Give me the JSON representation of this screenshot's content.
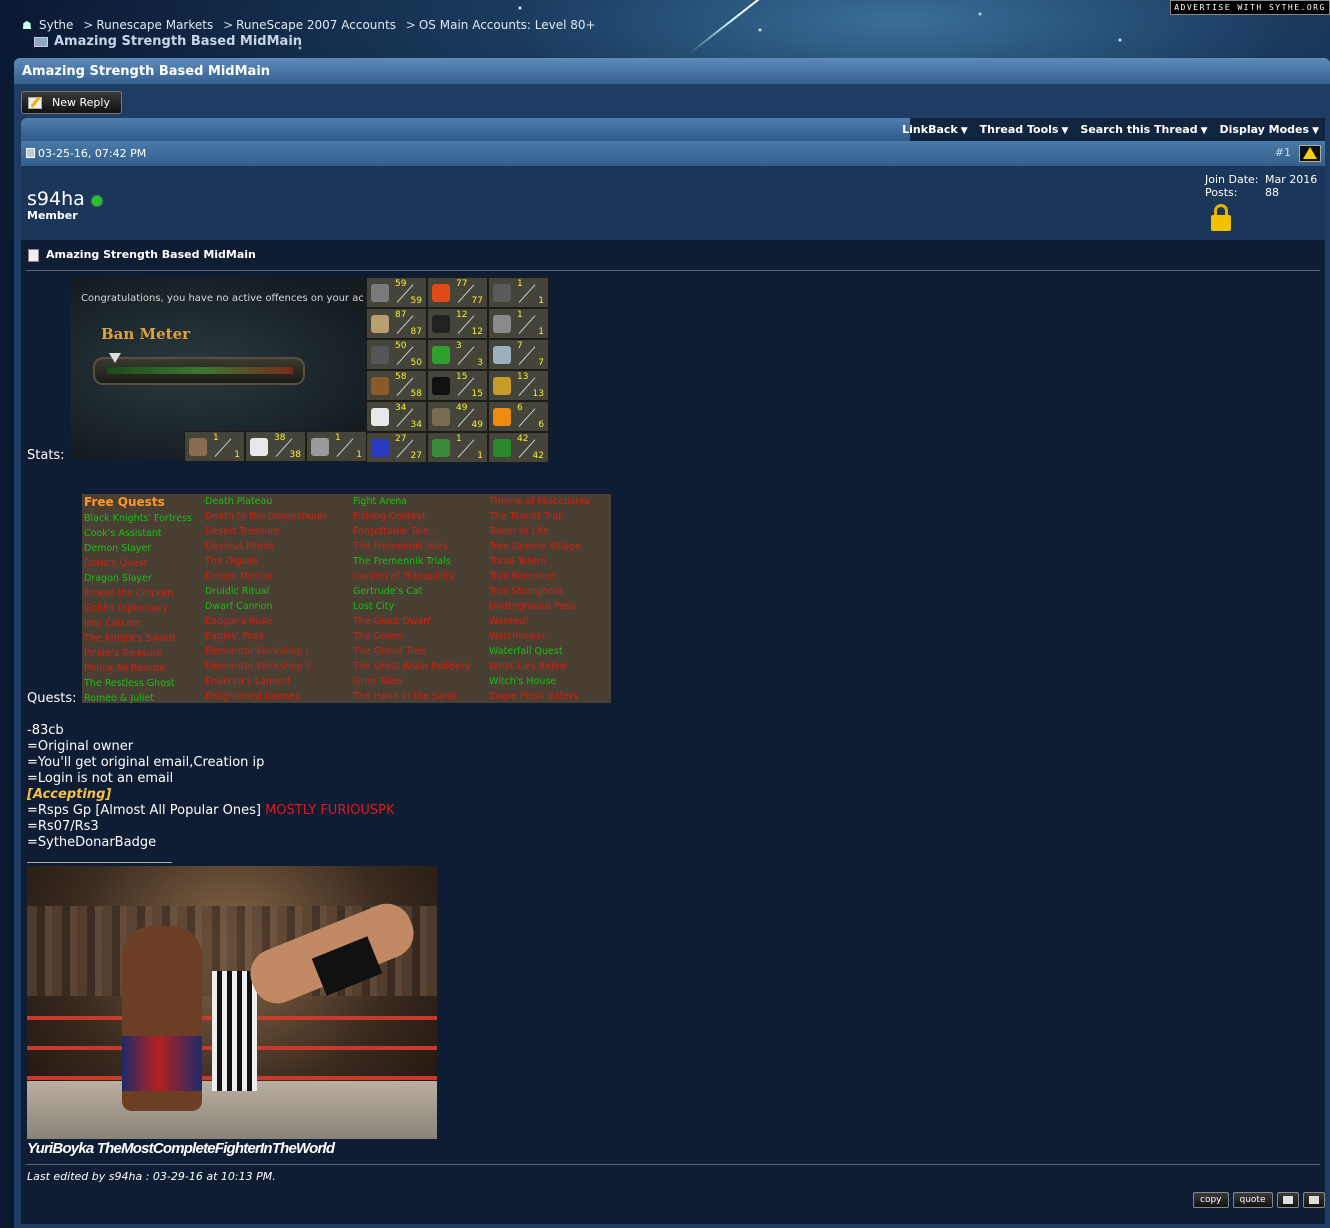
{
  "header": {
    "advertise": "ADVERTISE WITH SYTHE.ORG",
    "breadcrumb": [
      "Sythe",
      "Runescape Markets",
      "RuneScape 2007 Accounts",
      "OS Main Accounts: Level 80+"
    ],
    "breadcrumb_sep": ">",
    "current_thread": "Amazing Strength Based MidMain"
  },
  "thread": {
    "title": "Amazing Strength Based MidMain",
    "new_reply_label": "New Reply",
    "tools": [
      "LinkBack",
      "Thread Tools",
      "Search this Thread",
      "Display Modes"
    ]
  },
  "post": {
    "date": "03-25-16, 07:42 PM",
    "number": "#1",
    "username": "s94ha",
    "user_title": "Member",
    "join_date_label": "Join Date:",
    "join_date": "Mar 2016",
    "posts_label": "Posts:",
    "posts": "88",
    "title": "Amazing Strength Based MidMain",
    "stats_label": "Stats:",
    "quests_label": "Quests:",
    "lines": [
      "-83cb",
      "=Original owner",
      "=You'll get original email,Creation ip",
      "=Login is not an email"
    ],
    "accepting": "[Accepting]",
    "accept_line_prefix": "=Rsps Gp [Almost All Popular Ones]",
    "accept_line_highlight": "MOSTLY FURIOUSPK",
    "lines2": [
      "=Rs07/Rs3",
      "=SytheDonarBadge"
    ],
    "signature_caption": "YuriBoyka TheMostCompleteFighterInTheWorld",
    "edited": "Last edited by s94ha : 03-29-16 at 10:13 PM.",
    "buttons": {
      "copy": "copy",
      "quote": "quote"
    }
  },
  "ban_meter": {
    "congrats": "Congratulations, you have no active offences on your ac",
    "title": "Ban Meter"
  },
  "skills": [
    {
      "name": "attack-icon",
      "color": "#7a7a7a",
      "level": "59",
      "base": "59"
    },
    {
      "name": "hitpoints-icon",
      "color": "#e04a18",
      "level": "77",
      "base": "77"
    },
    {
      "name": "mining-icon",
      "color": "#5a5a5a",
      "level": "1",
      "base": "1"
    },
    {
      "name": "strength-icon",
      "color": "#b8a070",
      "level": "87",
      "base": "87"
    },
    {
      "name": "agility-icon",
      "color": "#222222",
      "level": "12",
      "base": "12"
    },
    {
      "name": "smithing-icon",
      "color": "#8a8a8a",
      "level": "1",
      "base": "1"
    },
    {
      "name": "defence-icon",
      "color": "#555555",
      "level": "50",
      "base": "50"
    },
    {
      "name": "herblore-icon",
      "color": "#2ea02e",
      "level": "3",
      "base": "3"
    },
    {
      "name": "fishing-icon",
      "color": "#9ab0c0",
      "level": "7",
      "base": "7"
    },
    {
      "name": "ranged-icon",
      "color": "#8a5a2a",
      "level": "58",
      "base": "58"
    },
    {
      "name": "thieving-icon",
      "color": "#111111",
      "level": "15",
      "base": "15"
    },
    {
      "name": "cooking-icon",
      "color": "#c89a2a",
      "level": "13",
      "base": "13"
    },
    {
      "name": "prayer-icon",
      "color": "#e8e8e8",
      "level": "34",
      "base": "34"
    },
    {
      "name": "crafting-icon",
      "color": "#7a6a50",
      "level": "49",
      "base": "49"
    },
    {
      "name": "firemaking-icon",
      "color": "#f08a10",
      "level": "6",
      "base": "6"
    },
    {
      "name": "magic-icon",
      "color": "#2a3ac0",
      "level": "27",
      "base": "27"
    },
    {
      "name": "fletching-icon",
      "color": "#3a8a3a",
      "level": "1",
      "base": "1"
    },
    {
      "name": "woodcutting-icon",
      "color": "#2a8a2a",
      "level": "42",
      "base": "42"
    }
  ],
  "skills_bottom": [
    {
      "name": "runecraft-icon",
      "color": "#8a6a50",
      "level": "1",
      "base": "1"
    },
    {
      "name": "slayer-icon",
      "color": "#e8e8e8",
      "level": "38",
      "base": "38"
    },
    {
      "name": "farming-icon",
      "color": "#9a9a9a",
      "level": "1",
      "base": "1"
    }
  ],
  "quests": {
    "header": "Free Quests",
    "columns": [
      [
        {
          "t": "Black Knights' Fortress",
          "c": "green"
        },
        {
          "t": "Cook's Assistant",
          "c": "green"
        },
        {
          "t": "Demon Slayer",
          "c": "green"
        },
        {
          "t": "Doric's Quest",
          "c": "red"
        },
        {
          "t": "Dragon Slayer",
          "c": "green"
        },
        {
          "t": "Ernest the Chicken",
          "c": "red"
        },
        {
          "t": "Goblin Diplomacy",
          "c": "red"
        },
        {
          "t": "Imp Catcher",
          "c": "red"
        },
        {
          "t": "The Knight's Sword",
          "c": "red"
        },
        {
          "t": "Pirate's Treasure",
          "c": "red"
        },
        {
          "t": "Prince Ali Rescue",
          "c": "red"
        },
        {
          "t": "The Restless Ghost",
          "c": "green"
        },
        {
          "t": "Romeo & Juliet",
          "c": "green"
        }
      ],
      [
        {
          "t": "Death Plateau",
          "c": "green"
        },
        {
          "t": "Death to the Dorgeshuun",
          "c": "red"
        },
        {
          "t": "Desert Treasure",
          "c": "red"
        },
        {
          "t": "Devious Minds",
          "c": "red"
        },
        {
          "t": "The Digsite",
          "c": "red"
        },
        {
          "t": "Dream Mentor",
          "c": "red"
        },
        {
          "t": "Druidic Ritual",
          "c": "green"
        },
        {
          "t": "Dwarf Cannon",
          "c": "green"
        },
        {
          "t": "Eadgar's Ruse",
          "c": "red"
        },
        {
          "t": "Eagles' Peak",
          "c": "red"
        },
        {
          "t": "Elemental Workshop I",
          "c": "red"
        },
        {
          "t": "Elemental Workshop II",
          "c": "red"
        },
        {
          "t": "Enakhra's Lament",
          "c": "red"
        },
        {
          "t": "Enlightened Journey",
          "c": "red"
        }
      ],
      [
        {
          "t": "Fight Arena",
          "c": "green"
        },
        {
          "t": "Fishing Contest",
          "c": "red"
        },
        {
          "t": "Forgettable Tale...",
          "c": "red"
        },
        {
          "t": "The Fremennik Isles",
          "c": "red"
        },
        {
          "t": "The Fremennik Trials",
          "c": "green"
        },
        {
          "t": "Garden of Tranquillity",
          "c": "red"
        },
        {
          "t": "Gertrude's Cat",
          "c": "green"
        },
        {
          "t": "Lost City",
          "c": "green"
        },
        {
          "t": "The Giant Dwarf",
          "c": "red"
        },
        {
          "t": "The Golem",
          "c": "red"
        },
        {
          "t": "The Grand Tree",
          "c": "red"
        },
        {
          "t": "The Great Brain Robbery",
          "c": "red"
        },
        {
          "t": "Grim Tales",
          "c": "red"
        },
        {
          "t": "The Hand in the Sand",
          "c": "red"
        }
      ],
      [
        {
          "t": "Throne of Miscellania",
          "c": "red"
        },
        {
          "t": "The Tourist Trap",
          "c": "red"
        },
        {
          "t": "Tower of Life",
          "c": "red"
        },
        {
          "t": "Tree Gnome Village",
          "c": "red"
        },
        {
          "t": "Tribal Totem",
          "c": "red"
        },
        {
          "t": "Troll Romance",
          "c": "red"
        },
        {
          "t": "Troll Stronghold",
          "c": "red"
        },
        {
          "t": "Underground Pass",
          "c": "red"
        },
        {
          "t": "Wanted!",
          "c": "red"
        },
        {
          "t": "Watchtower",
          "c": "red"
        },
        {
          "t": "Waterfall Quest",
          "c": "green"
        },
        {
          "t": "What Lies Below",
          "c": "red"
        },
        {
          "t": "Witch's House",
          "c": "green"
        },
        {
          "t": "Zogre Flesh Eaters",
          "c": "red"
        }
      ]
    ]
  }
}
